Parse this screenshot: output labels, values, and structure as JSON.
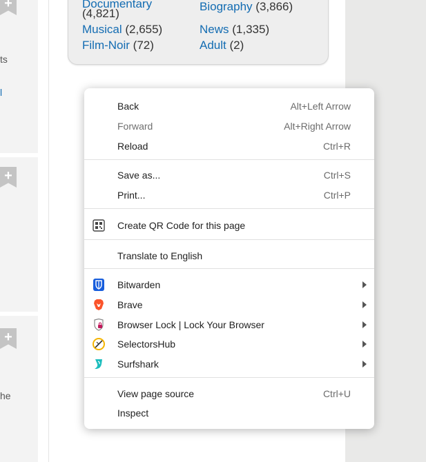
{
  "left_column": {
    "fragment_1": "ts",
    "fragment_2": "l",
    "fragment_3": "he",
    "bookmark_symbol": "+"
  },
  "genres": [
    {
      "name": "Documentary",
      "count": "(4,821)"
    },
    {
      "name": "Biography",
      "count": "(3,866)"
    },
    {
      "name": "Musical",
      "count": "(2,655)"
    },
    {
      "name": "News",
      "count": "(1,335)"
    },
    {
      "name": "Film-Noir",
      "count": "(72)"
    },
    {
      "name": "Adult",
      "count": "(2)"
    }
  ],
  "context_menu": {
    "back": {
      "label": "Back",
      "shortcut": "Alt+Left Arrow"
    },
    "forward": {
      "label": "Forward",
      "shortcut": "Alt+Right Arrow"
    },
    "reload": {
      "label": "Reload",
      "shortcut": "Ctrl+R"
    },
    "save_as": {
      "label": "Save as...",
      "shortcut": "Ctrl+S"
    },
    "print": {
      "label": "Print...",
      "shortcut": "Ctrl+P"
    },
    "qr_code": {
      "label": "Create QR Code for this page",
      "icon": "qr-code-icon"
    },
    "translate": {
      "label": "Translate to English"
    },
    "extensions": [
      {
        "label": "Bitwarden",
        "icon": "bitwarden-icon",
        "color": "#175ddc"
      },
      {
        "label": "Brave",
        "icon": "brave-icon",
        "color": "#fb542b"
      },
      {
        "label": "Browser Lock | Lock Your Browser",
        "icon": "browser-lock-icon",
        "color": "#c2185b"
      },
      {
        "label": "SelectorsHub",
        "icon": "selectorshub-icon",
        "color": "#f4b400"
      },
      {
        "label": "Surfshark",
        "icon": "surfshark-icon",
        "color": "#1cbdbd"
      }
    ],
    "view_source": {
      "label": "View page source",
      "shortcut": "Ctrl+U"
    },
    "inspect": {
      "label": "Inspect"
    }
  }
}
